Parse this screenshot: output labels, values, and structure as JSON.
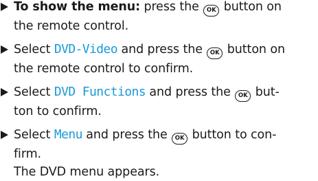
{
  "steps": [
    {
      "bold": "To show the menu:",
      "a": "press the",
      "b": "button on",
      "cont": "the remote control."
    },
    {
      "a": "Select",
      "hl": "DVD-Video",
      "b": "and press the",
      "c": "button on",
      "cont": "the remote control to confirm."
    },
    {
      "a": "Select",
      "hl": "DVD Functions",
      "b": "and press the",
      "c": "but-",
      "cont": "ton to confirm."
    },
    {
      "a": "Select",
      "hl": "Menu",
      "b": "and press the",
      "c": "button to con-",
      "cont": "firm."
    }
  ],
  "ok_label": "OK",
  "result": "The DVD menu appears.",
  "colors": {
    "highlight": "#1b9ad6",
    "text": "#1a1a1a"
  }
}
